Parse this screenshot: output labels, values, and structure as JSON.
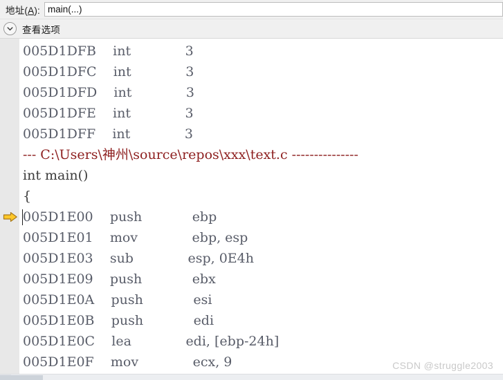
{
  "toolbar": {
    "address_label_prefix": "地址(",
    "address_label_mnemonic": "A",
    "address_label_suffix": "):",
    "address_label_full": "地址(A):",
    "address_value": "main(...)",
    "address_placeholder": "main(...)"
  },
  "expander": {
    "icon": "chevron-down-icon",
    "label": "查看选项",
    "expanded": false
  },
  "disassembly": {
    "rows": [
      {
        "type": "instruction",
        "address": "005D1DFB",
        "mnemonic": "int",
        "operands": "3",
        "current": false
      },
      {
        "type": "instruction",
        "address": "005D1DFC",
        "mnemonic": "int",
        "operands": "3",
        "current": false
      },
      {
        "type": "instruction",
        "address": "005D1DFD",
        "mnemonic": "int",
        "operands": "3",
        "current": false
      },
      {
        "type": "instruction",
        "address": "005D1DFE",
        "mnemonic": "int",
        "operands": "3",
        "current": false
      },
      {
        "type": "instruction",
        "address": "005D1DFF",
        "mnemonic": "int",
        "operands": "3",
        "current": false
      },
      {
        "type": "sourcefile",
        "text": "--- C:\\Users\\神州\\source\\repos\\xxx\\text.c ---------------",
        "current": false
      },
      {
        "type": "source",
        "text": "int main()",
        "current": false
      },
      {
        "type": "source",
        "text": "{",
        "current": false
      },
      {
        "type": "instruction",
        "address": "005D1E00",
        "mnemonic": "push",
        "operands": "ebp",
        "current": true
      },
      {
        "type": "instruction",
        "address": "005D1E01",
        "mnemonic": "mov",
        "operands": "ebp, esp",
        "current": false
      },
      {
        "type": "instruction",
        "address": "005D1E03",
        "mnemonic": "sub",
        "operands": "esp, 0E4h",
        "current": false
      },
      {
        "type": "instruction",
        "address": "005D1E09",
        "mnemonic": "push",
        "operands": "ebx",
        "current": false
      },
      {
        "type": "instruction",
        "address": "005D1E0A",
        "mnemonic": "push",
        "operands": "esi",
        "current": false
      },
      {
        "type": "instruction",
        "address": "005D1E0B",
        "mnemonic": "push",
        "operands": "edi",
        "current": false
      },
      {
        "type": "instruction",
        "address": "005D1E0C",
        "mnemonic": "lea",
        "operands": "edi, [ebp-24h]",
        "current": false
      },
      {
        "type": "instruction",
        "address": "005D1E0F",
        "mnemonic": "mov",
        "operands": "ecx, 9",
        "current": false
      }
    ],
    "execution_marker": "execution-pointer-arrow-icon"
  },
  "watermark": {
    "text": "CSDN @struggle2003"
  },
  "colors": {
    "source_file_line": "#8e2020",
    "code_text": "#585c68",
    "source_text": "#3b3b3b",
    "gutter": "#e8e8e8",
    "toolbar": "#f0f0f0",
    "exec_arrow_fill": "#ffc829",
    "exec_arrow_stroke": "#a8791a"
  }
}
